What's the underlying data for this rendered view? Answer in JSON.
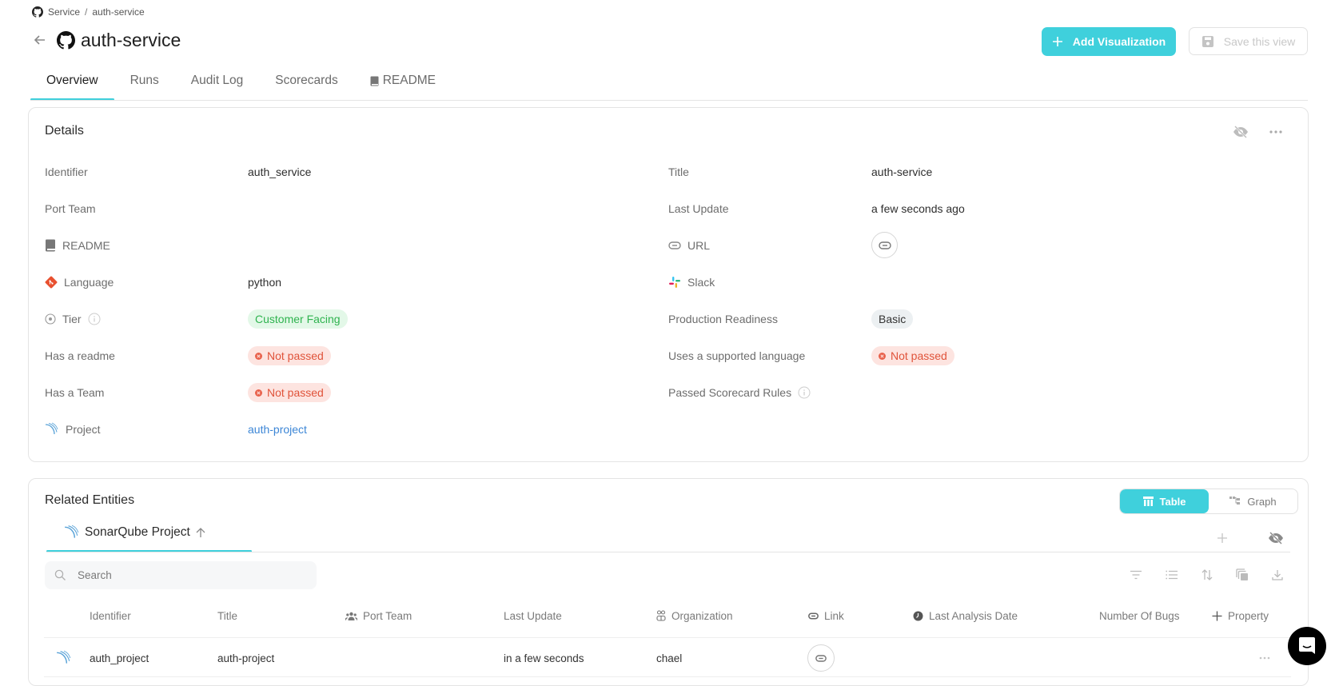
{
  "breadcrumb": {
    "items": [
      "Service",
      "auth-service"
    ],
    "separator": "/"
  },
  "header": {
    "title": "auth-service",
    "add_visualization_label": "Add Visualization",
    "save_view_label": "Save this view"
  },
  "tabs": [
    {
      "label": "Overview",
      "active": true
    },
    {
      "label": "Runs",
      "active": false
    },
    {
      "label": "Audit Log",
      "active": false
    },
    {
      "label": "Scorecards",
      "active": false
    },
    {
      "label": "README",
      "active": false,
      "icon": "book-icon"
    }
  ],
  "details": {
    "title": "Details",
    "left": [
      {
        "label": "Identifier",
        "value": "auth_service"
      },
      {
        "label": "Port Team",
        "value": ""
      },
      {
        "label": "README",
        "icon": "book-icon",
        "value": ""
      },
      {
        "label": "Language",
        "icon": "git-icon",
        "value": "python"
      },
      {
        "label": "Tier",
        "icon": "radio-icon",
        "info": true,
        "value": "Customer Facing",
        "badge": "green"
      },
      {
        "label": "Has a readme",
        "value": "Not passed",
        "badge": "red"
      },
      {
        "label": "Has a Team",
        "value": "Not passed",
        "badge": "red"
      },
      {
        "label": "Project",
        "icon": "sonarqube-icon",
        "value": "auth-project",
        "link": true
      }
    ],
    "right": [
      {
        "label": "Title",
        "value": "auth-service"
      },
      {
        "label": "Last Update",
        "value": "a few seconds ago"
      },
      {
        "label": "URL",
        "icon": "link-icon",
        "value": "",
        "link_button": true
      },
      {
        "label": "Slack",
        "icon": "slack-icon",
        "value": ""
      },
      {
        "label": "Production Readiness",
        "value": "Basic",
        "badge": "gray"
      },
      {
        "label": "Uses a supported language",
        "value": "Not passed",
        "badge": "red"
      },
      {
        "label": "Passed Scorecard Rules",
        "info": true,
        "value": ""
      }
    ]
  },
  "related": {
    "title": "Related Entities",
    "view_toggle": {
      "table_label": "Table",
      "graph_label": "Graph",
      "selected": "Table"
    },
    "tab_label": "SonarQube Project",
    "search_placeholder": "Search",
    "columns": [
      {
        "label": "Identifier"
      },
      {
        "label": "Title"
      },
      {
        "label": "Port Team",
        "icon": "team-icon"
      },
      {
        "label": "Last Update"
      },
      {
        "label": "Organization",
        "icon": "organization-icon"
      },
      {
        "label": "Link",
        "icon": "link-icon"
      },
      {
        "label": "Last Analysis Date",
        "icon": "clock-icon"
      },
      {
        "label": "Number Of Bugs"
      },
      {
        "label": "Property",
        "icon": "plus-icon"
      }
    ],
    "rows": [
      {
        "identifier": "auth_project",
        "title": "auth-project",
        "port_team": "",
        "last_update": "in a few seconds",
        "organization": "chael",
        "link": "",
        "last_analysis_date": "",
        "number_of_bugs": ""
      }
    ]
  },
  "colors": {
    "accent": "#3fd0dc",
    "link": "#3c86d6",
    "success": "#2fb34f",
    "danger": "#e0533a"
  }
}
